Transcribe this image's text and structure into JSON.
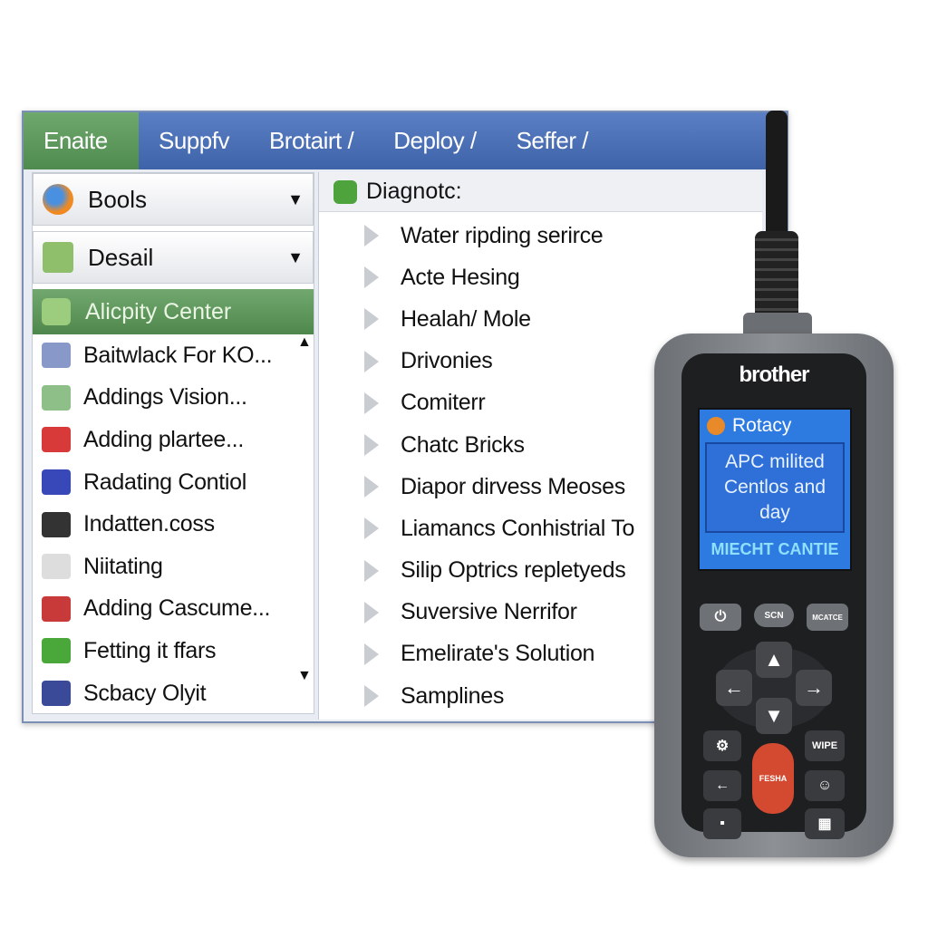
{
  "tabs": [
    {
      "label": "Enaite",
      "active": true
    },
    {
      "label": "Suppfv"
    },
    {
      "label": "Brotairt /"
    },
    {
      "label": "Deploy /"
    },
    {
      "label": "Seffer /"
    }
  ],
  "left": {
    "dropdowns": [
      {
        "label": "Bools",
        "icon": "browser-globe-icon"
      },
      {
        "label": "Desail",
        "icon": "network-icon"
      }
    ],
    "selected": {
      "label": "Alicpity Center",
      "icon": "app-center-icon"
    },
    "items": [
      {
        "label": "Baitwlack For KO...",
        "icon": "printer-icon"
      },
      {
        "label": "Addings Vision...",
        "icon": "scanner-icon"
      },
      {
        "label": "Adding plartee...",
        "icon": "red-badge-icon"
      },
      {
        "label": "Radating Contiol",
        "icon": "monitor-icon"
      },
      {
        "label": "Indatten.coss",
        "icon": "tower-icon"
      },
      {
        "label": "Niitating",
        "icon": "document-icon"
      },
      {
        "label": "Adding Cascume...",
        "icon": "tools-icon"
      },
      {
        "label": "Fetting it ffars",
        "icon": "green-chat-icon"
      },
      {
        "label": "Scbacy Olyit",
        "icon": "tablet-icon"
      }
    ],
    "scroll_up": "▲",
    "scroll_down": "▼"
  },
  "right": {
    "header": "Diagnotc:",
    "items": [
      "Water ripding serirce",
      "Acte Hesing",
      "Healah/ Mole",
      "Drivonies",
      "Comiterr",
      "Chatc Bricks",
      "Diapor dirvess Meoses",
      "Liamancs Conhistrial To",
      "Silip Optrics repletyeds",
      "Suversive Nerrifor",
      "Emelirate's Solution",
      "Samplines"
    ]
  },
  "device": {
    "brand": "brother",
    "screen_title": "Rotacy",
    "screen_message": [
      "APC milited",
      "Centlos and",
      "day"
    ],
    "screen_footer": "MIECHT CANTIE",
    "buttons": {
      "top_left": "power-icon",
      "top_mid": "SCN",
      "top_right": "MCATCE",
      "wipe": "WIPE",
      "red": "FESHA"
    },
    "colors": {
      "screen": "#2d7be0",
      "red_button": "#d34a30"
    }
  },
  "colors": {
    "tab_bar": "#4a6fb5",
    "active_green": "#5a9a5a"
  }
}
